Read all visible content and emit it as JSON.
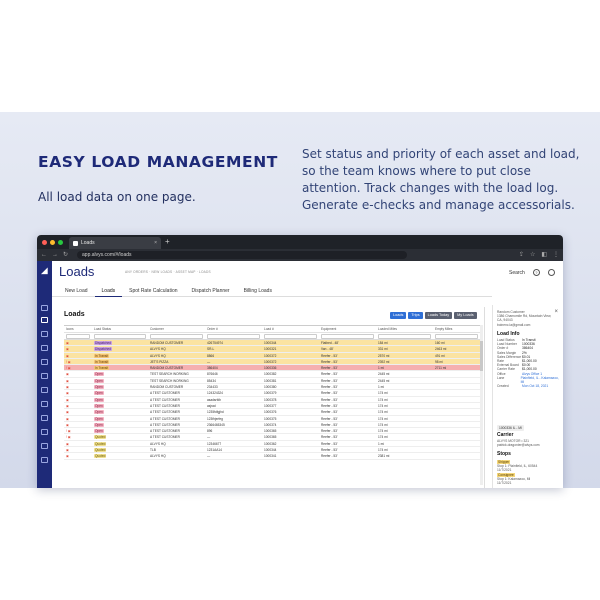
{
  "hero": {
    "title": "EASY LOAD MANAGEMENT",
    "subtitle": "All load data on one page.",
    "description": "Set status and priority of each asset and load, so the team knows where to put close attention. Track changes with the load log. Generate e-checks and manage accessorials."
  },
  "browser": {
    "tab_title": "Loads",
    "url": "app.alvys.com/#/loads",
    "tab_close": "×",
    "new_tab": "+"
  },
  "app": {
    "title": "Loads",
    "breadcrumbs": "ANY ORDERS  ·  NEW LOADS  ·  ASSET MAP  ·  LOADS",
    "search_label": "Search",
    "subtabs": [
      "New Load",
      "Loads",
      "Spot Rate Calculation",
      "Dispatch Planner",
      "Billing Loads"
    ],
    "active_subtab": "Loads"
  },
  "panel": {
    "title": "Loads",
    "buttons": [
      "Loads",
      "Trips",
      "Loads Today",
      "My Loads"
    ],
    "columns": [
      "Icons",
      "Load Status",
      "Customer",
      "Order #",
      "Load #",
      "Equipment",
      "Loaded Miles",
      "Empty Miles"
    ]
  },
  "rows": [
    {
      "hl": "yellow",
      "icons": "▣",
      "status": "Dispatched",
      "kind": "dispatched",
      "customer": "RANDOM CUSTOMER",
      "order": "426754974",
      "load": "1000344",
      "equip": "Flatbed - 48'",
      "miles": "184 mi",
      "empty": "160 mi"
    },
    {
      "hl": "yellow",
      "icons": "▣",
      "status": "Dispatched",
      "kind": "dispatched",
      "customer": "ALVYS HQ",
      "order": "SR-L",
      "load": "1000321",
      "equip": "Van - 48'",
      "miles": "331 mi",
      "empty": "2463 mi"
    },
    {
      "hl": "yellow",
      "icons": "▣",
      "status": "In Transit",
      "kind": "transit",
      "customer": "ALVYS HQ",
      "order": "8866",
      "load": "1000372",
      "equip": "Reefer - 53'",
      "miles": "2570 mi",
      "empty": "491 mi"
    },
    {
      "hl": "yellow",
      "icons": "! ▣",
      "status": "In Transit",
      "kind": "transit",
      "customer": "JET'S PIZZA",
      "order": "—",
      "load": "1000372",
      "equip": "Reefer - 53'",
      "miles": "2392 mi",
      "empty": "98 mi"
    },
    {
      "hl": "red",
      "icons": "! ▣",
      "status": "In Transit",
      "kind": "transit",
      "customer": "RANDOM CUSTOMER",
      "order": "386404",
      "load": "1000336",
      "equip": "Reefer - 53'",
      "miles": "1 mi",
      "empty": "2711 mi"
    },
    {
      "hl": "",
      "icons": "▣",
      "status": "Open",
      "kind": "open",
      "customer": "TEST SEARCH WORKING",
      "order": "876646",
      "load": "1000382",
      "equip": "Reefer - 53'",
      "miles": "2445 mi",
      "empty": ""
    },
    {
      "hl": "",
      "icons": "▣",
      "status": "Open",
      "kind": "open",
      "customer": "TEST SEARCH WORKING",
      "order": "85434",
      "load": "1000381",
      "equip": "Reefer - 53'",
      "miles": "2445 mi",
      "empty": ""
    },
    {
      "hl": "",
      "icons": "▣",
      "status": "Open",
      "kind": "open",
      "customer": "RANDOM CUSTOMER",
      "order": "234433",
      "load": "1000380",
      "equip": "Reefer - 53'",
      "miles": "1 mi",
      "empty": ""
    },
    {
      "hl": "",
      "icons": "▣",
      "status": "Open",
      "kind": "open",
      "customer": "A TEST CUSTOMER",
      "order": "124324324",
      "load": "1000379",
      "equip": "Reefer - 53'",
      "miles": "174 mi",
      "empty": ""
    },
    {
      "hl": "",
      "icons": "▣",
      "status": "Open",
      "kind": "open",
      "customer": "A TEST CUSTOMER",
      "order": "asadsrfdh",
      "load": "1000378",
      "equip": "Reefer - 53'",
      "miles": "174 mi",
      "empty": ""
    },
    {
      "hl": "",
      "icons": "▣",
      "status": "Open",
      "kind": "open",
      "customer": "A TEST CUSTOMER",
      "order": "asjrad",
      "load": "1000377",
      "equip": "Reefer - 53'",
      "miles": "174 mi",
      "empty": ""
    },
    {
      "hl": "",
      "icons": "▣",
      "status": "Open",
      "kind": "open",
      "customer": "A TEST CUSTOMER",
      "order": "1235fdfgjhd",
      "load": "1000376",
      "equip": "Reefer - 53'",
      "miles": "174 mi",
      "empty": ""
    },
    {
      "hl": "",
      "icons": "▣",
      "status": "Open",
      "kind": "open",
      "customer": "A TEST CUSTOMER",
      "order": "123fhjerfeg",
      "load": "1000375",
      "equip": "Reefer - 53'",
      "miles": "174 mi",
      "empty": ""
    },
    {
      "hl": "",
      "icons": "▣",
      "status": "Open",
      "kind": "open",
      "customer": "A TEST CUSTOMER",
      "order": "2366465345",
      "load": "1000374",
      "equip": "Reefer - 53'",
      "miles": "174 mi",
      "empty": ""
    },
    {
      "hl": "",
      "icons": "! ▣",
      "status": "Open",
      "kind": "open",
      "customer": "A TEST CUSTOMER",
      "order": "896",
      "load": "1000365",
      "equip": "Reefer - 53'",
      "miles": "174 mi",
      "empty": ""
    },
    {
      "hl": "",
      "icons": "! ▣",
      "status": "Quoted",
      "kind": "quoted",
      "customer": "A TEST CUSTOMER",
      "order": "—",
      "load": "1000365",
      "equip": "Reefer - 53'",
      "miles": "174 mi",
      "empty": ""
    },
    {
      "hl": "",
      "icons": "▣",
      "status": "Quoted",
      "kind": "quoted",
      "customer": "ALVYS HQ",
      "order": "12346677",
      "load": "1000362",
      "equip": "Reefer - 53'",
      "miles": "1 mi",
      "empty": ""
    },
    {
      "hl": "",
      "icons": "▣",
      "status": "Quoted",
      "kind": "quoted",
      "customer": "TLB",
      "order": "1231AA14",
      "load": "1000344",
      "equip": "Reefer - 53'",
      "miles": "174 mi",
      "empty": ""
    },
    {
      "hl": "",
      "icons": "▣",
      "status": "Quoted",
      "kind": "quoted",
      "customer": "ALVYS HQ",
      "order": "—",
      "load": "1000341",
      "equip": "Reefer - 53'",
      "miles": "2381 mi",
      "empty": ""
    }
  ],
  "side": {
    "address": "Random Customer\n1386 Chamomile Rd, Mountain View, CA, 94043\nboinenc.la@gmail.com",
    "load_info_title": "Load Info",
    "load_info": [
      [
        "Load Status",
        "In Transit"
      ],
      [
        "Load Number",
        "1000336"
      ],
      [
        "Order #",
        "386404"
      ],
      [
        "Sales Margin",
        "2%"
      ],
      [
        "Sales Difference",
        "$0.01"
      ],
      [
        "Rate",
        "$1,000.00"
      ],
      [
        "External Board",
        "$0.00"
      ],
      [
        "Carrier Rate",
        "$1,000.00"
      ],
      [
        "Office",
        "Alvys Office 1"
      ],
      [
        "Lane",
        "Plainfield, IL - Kalamazoo, MI"
      ],
      [
        "Created",
        "Mon Oct 18, 2021"
      ]
    ],
    "mc": "1000336 IL - MI",
    "carrier_title": "Carrier",
    "carrier": "ALVYS MOTOR • 321\npatrick.dragonier@alvys.com",
    "stops_title": "Stops",
    "stop1_tag": "Shipper",
    "stop1": "Stop 1: Plainfield, IL, 60544\n11/7/2021",
    "stop2_tag": "Consignee",
    "stop2": "Stop 1: Kalamazoo, MI\n11/7/2021",
    "close": "×"
  },
  "colors": {
    "brand": "#1e2a78",
    "highlight_yellow": "#fbe3a1",
    "highlight_red": "#f5b0b0",
    "primary_button": "#2f6fd6"
  },
  "icons": {
    "tab": "alvys-logo-icon",
    "rail": [
      "logo-icon",
      "loads-icon",
      "truck-icon",
      "calendar-icon",
      "document-icon",
      "map-icon",
      "settings-icon"
    ]
  }
}
